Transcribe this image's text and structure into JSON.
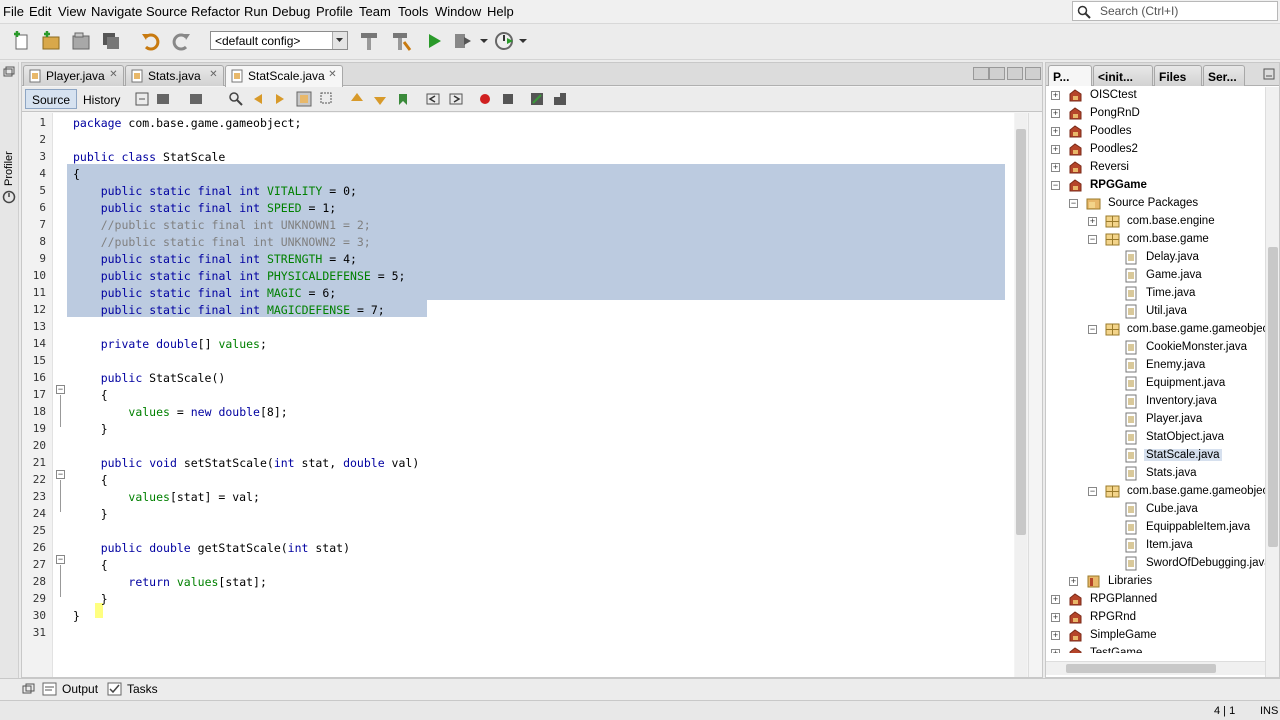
{
  "menu": [
    "File",
    "Edit",
    "View",
    "Navigate",
    "Source",
    "Refactor",
    "Run",
    "Debug",
    "Profile",
    "Team",
    "Tools",
    "Window",
    "Help"
  ],
  "search": {
    "placeholder": "Search (Ctrl+I)"
  },
  "toolbar": {
    "config": "<default config>"
  },
  "left_strip": {
    "profiler": "Profiler"
  },
  "editor": {
    "tabs": [
      {
        "label": "Player.java",
        "active": false
      },
      {
        "label": "Stats.java",
        "active": false
      },
      {
        "label": "StatScale.java",
        "active": true
      }
    ],
    "source_label": "Source",
    "history_label": "History",
    "lines": [
      "package com.base.game.gameobject;",
      "",
      "public class StatScale",
      "{",
      "    public static final int VITALITY = 0;",
      "    public static final int SPEED = 1;",
      "    //public static final int UNKNOWN1 = 2;",
      "    //public static final int UNKNOWN2 = 3;",
      "    public static final int STRENGTH = 4;",
      "    public static final int PHYSICALDEFENSE = 5;",
      "    public static final int MAGIC = 6;",
      "    public static final int MAGICDEFENSE = 7;",
      "",
      "    private double[] values;",
      "",
      "    public StatScale()",
      "    {",
      "        values = new double[8];",
      "    }",
      "",
      "    public void setStatScale(int stat, double val)",
      "    {",
      "        values[stat] = val;",
      "    }",
      "",
      "    public double getStatScale(int stat)",
      "    {",
      "        return values[stat];",
      "    }",
      "}",
      ""
    ]
  },
  "right_panel": {
    "tabs": [
      "P...",
      "<init...",
      "Files",
      "Ser..."
    ],
    "tree": [
      {
        "label": "OISCtest",
        "level": 0,
        "type": "project",
        "expanded": false
      },
      {
        "label": "PongRnD",
        "level": 0,
        "type": "project",
        "expanded": false
      },
      {
        "label": "Poodles",
        "level": 0,
        "type": "project",
        "expanded": false
      },
      {
        "label": "Poodles2",
        "level": 0,
        "type": "project",
        "expanded": false
      },
      {
        "label": "Reversi",
        "level": 0,
        "type": "project",
        "expanded": false
      },
      {
        "label": "RPGGame",
        "level": 0,
        "type": "project",
        "expanded": true,
        "bold": true
      },
      {
        "label": "Source Packages",
        "level": 1,
        "type": "folder",
        "expanded": true
      },
      {
        "label": "com.base.engine",
        "level": 2,
        "type": "package",
        "expanded": false
      },
      {
        "label": "com.base.game",
        "level": 2,
        "type": "package",
        "expanded": true
      },
      {
        "label": "Delay.java",
        "level": 3,
        "type": "file"
      },
      {
        "label": "Game.java",
        "level": 3,
        "type": "file"
      },
      {
        "label": "Time.java",
        "level": 3,
        "type": "file"
      },
      {
        "label": "Util.java",
        "level": 3,
        "type": "file"
      },
      {
        "label": "com.base.game.gameobject",
        "level": 2,
        "type": "package",
        "expanded": true
      },
      {
        "label": "CookieMonster.java",
        "level": 3,
        "type": "file"
      },
      {
        "label": "Enemy.java",
        "level": 3,
        "type": "file"
      },
      {
        "label": "Equipment.java",
        "level": 3,
        "type": "file"
      },
      {
        "label": "Inventory.java",
        "level": 3,
        "type": "file"
      },
      {
        "label": "Player.java",
        "level": 3,
        "type": "file"
      },
      {
        "label": "StatObject.java",
        "level": 3,
        "type": "file"
      },
      {
        "label": "StatScale.java",
        "level": 3,
        "type": "file",
        "selected": true
      },
      {
        "label": "Stats.java",
        "level": 3,
        "type": "file"
      },
      {
        "label": "com.base.game.gameobject.item",
        "level": 2,
        "type": "package",
        "expanded": true
      },
      {
        "label": "Cube.java",
        "level": 3,
        "type": "file"
      },
      {
        "label": "EquippableItem.java",
        "level": 3,
        "type": "file"
      },
      {
        "label": "Item.java",
        "level": 3,
        "type": "file"
      },
      {
        "label": "SwordOfDebugging.java",
        "level": 3,
        "type": "file"
      },
      {
        "label": "Libraries",
        "level": 1,
        "type": "library",
        "expanded": false
      },
      {
        "label": "RPGPlanned",
        "level": 0,
        "type": "project",
        "expanded": false
      },
      {
        "label": "RPGRnd",
        "level": 0,
        "type": "project",
        "expanded": false
      },
      {
        "label": "SimpleGame",
        "level": 0,
        "type": "project",
        "expanded": false
      },
      {
        "label": "TestGame",
        "level": 0,
        "type": "project",
        "expanded": false
      }
    ]
  },
  "bottom": {
    "output": "Output",
    "tasks": "Tasks"
  },
  "status": {
    "position": "4 | 1",
    "mode": "INS"
  },
  "colors": {
    "selection": "#bccbe0",
    "keyword": "#0000a0",
    "field": "#008000",
    "comment": "#808080"
  }
}
